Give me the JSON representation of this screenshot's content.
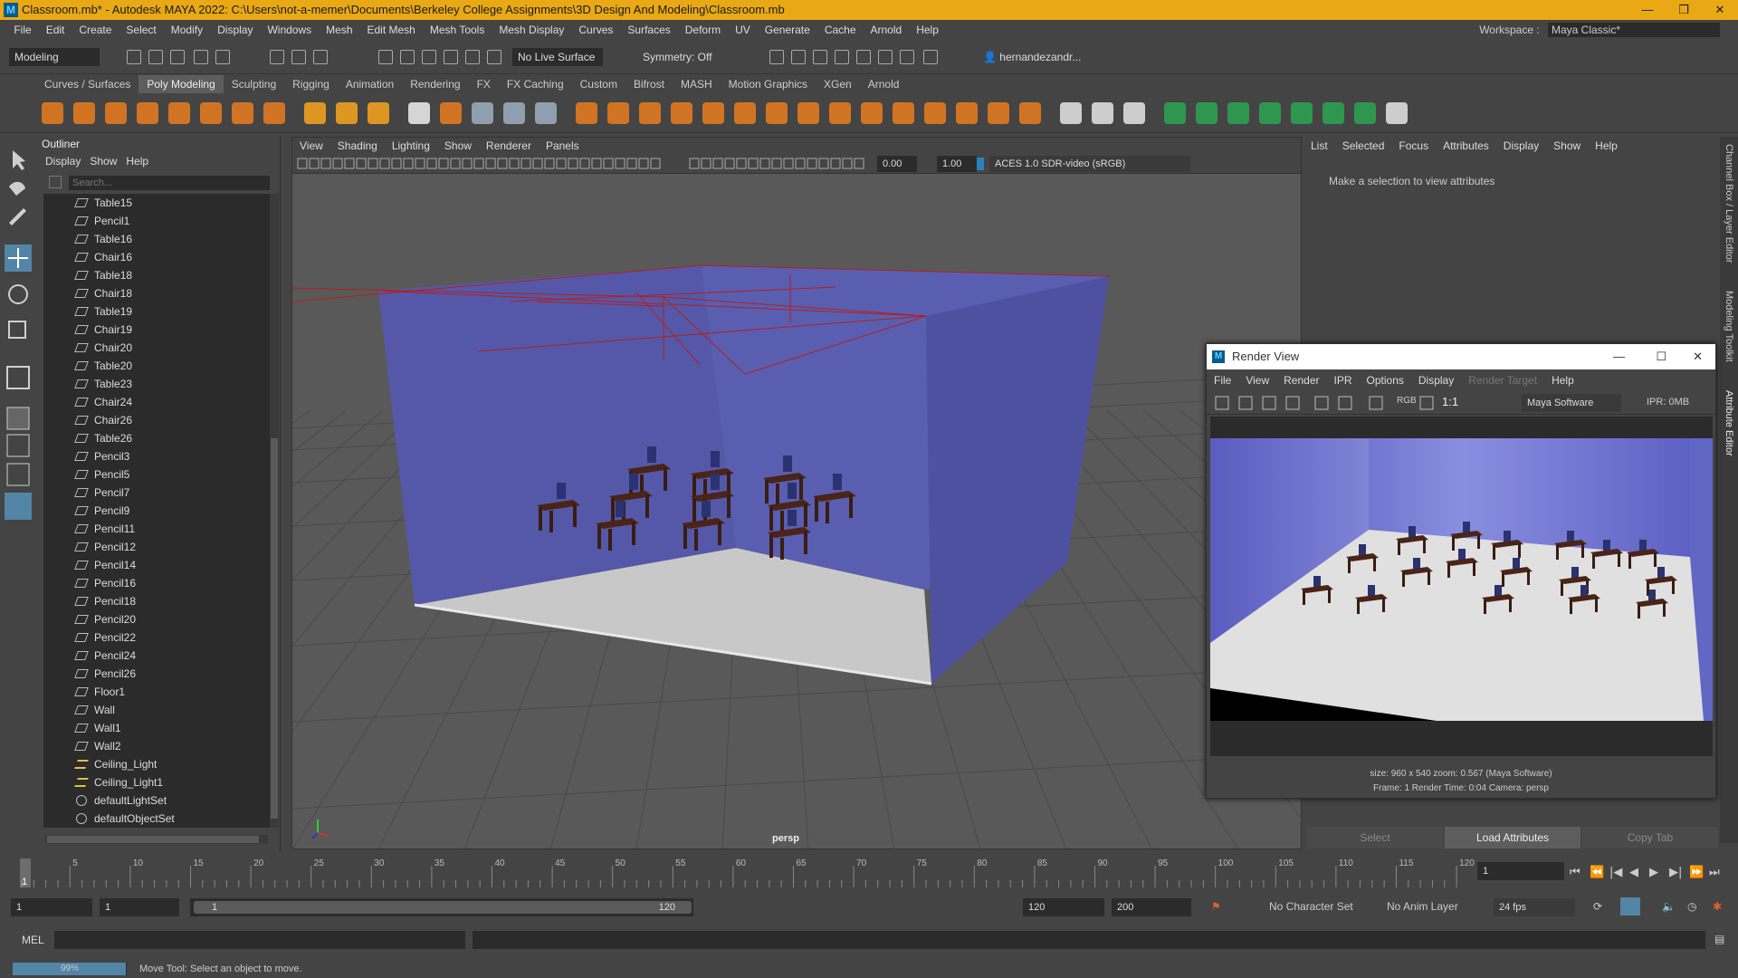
{
  "title": "Classroom.mb* - Autodesk MAYA 2022: C:\\Users\\not-a-memer\\Documents\\Berkeley College Assignments\\3D Design And Modeling\\Classroom.mb",
  "window_controls": {
    "minimize": "—",
    "maximize": "❐",
    "close": "✕"
  },
  "menubar": {
    "items": [
      "File",
      "Edit",
      "Create",
      "Select",
      "Modify",
      "Display",
      "Windows",
      "Mesh",
      "Edit Mesh",
      "Mesh Tools",
      "Mesh Display",
      "Curves",
      "Surfaces",
      "Deform",
      "UV",
      "Generate",
      "Cache",
      "Arnold",
      "Help"
    ],
    "workspace_label": "Workspace :",
    "workspace_value": "Maya Classic*"
  },
  "statusline": {
    "mode": "Modeling",
    "live_surface": "No Live Surface",
    "symmetry": "Symmetry: Off",
    "user": "hernandezandr..."
  },
  "shelf_tabs": [
    "Curves / Surfaces",
    "Poly Modeling",
    "Sculpting",
    "Rigging",
    "Animation",
    "Rendering",
    "FX",
    "FX Caching",
    "Custom",
    "Bifrost",
    "MASH",
    "Motion Graphics",
    "XGen",
    "Arnold"
  ],
  "shelf_active": "Poly Modeling",
  "outliner": {
    "title": "Outliner",
    "menu": [
      "Display",
      "Show",
      "Help"
    ],
    "search_placeholder": "Search...",
    "items": [
      {
        "name": "Table15",
        "type": "mesh"
      },
      {
        "name": "Pencil1",
        "type": "mesh"
      },
      {
        "name": "Table16",
        "type": "mesh"
      },
      {
        "name": "Chair16",
        "type": "mesh"
      },
      {
        "name": "Table18",
        "type": "mesh"
      },
      {
        "name": "Chair18",
        "type": "mesh"
      },
      {
        "name": "Table19",
        "type": "mesh"
      },
      {
        "name": "Chair19",
        "type": "mesh"
      },
      {
        "name": "Chair20",
        "type": "mesh"
      },
      {
        "name": "Table20",
        "type": "mesh"
      },
      {
        "name": "Table23",
        "type": "mesh"
      },
      {
        "name": "Chair24",
        "type": "mesh"
      },
      {
        "name": "Chair26",
        "type": "mesh"
      },
      {
        "name": "Table26",
        "type": "mesh"
      },
      {
        "name": "Pencil3",
        "type": "mesh"
      },
      {
        "name": "Pencil5",
        "type": "mesh"
      },
      {
        "name": "Pencil7",
        "type": "mesh"
      },
      {
        "name": "Pencil9",
        "type": "mesh"
      },
      {
        "name": "Pencil11",
        "type": "mesh"
      },
      {
        "name": "Pencil12",
        "type": "mesh"
      },
      {
        "name": "Pencil14",
        "type": "mesh"
      },
      {
        "name": "Pencil16",
        "type": "mesh"
      },
      {
        "name": "Pencil18",
        "type": "mesh"
      },
      {
        "name": "Pencil20",
        "type": "mesh"
      },
      {
        "name": "Pencil22",
        "type": "mesh"
      },
      {
        "name": "Pencil24",
        "type": "mesh"
      },
      {
        "name": "Pencil26",
        "type": "mesh"
      },
      {
        "name": "Floor1",
        "type": "mesh"
      },
      {
        "name": "Wall",
        "type": "mesh"
      },
      {
        "name": "Wall1",
        "type": "mesh"
      },
      {
        "name": "Wall2",
        "type": "mesh"
      },
      {
        "name": "Ceiling_Light",
        "type": "light"
      },
      {
        "name": "Ceiling_Light1",
        "type": "light"
      },
      {
        "name": "defaultLightSet",
        "type": "set"
      },
      {
        "name": "defaultObjectSet",
        "type": "set"
      }
    ]
  },
  "viewport": {
    "menu": [
      "View",
      "Shading",
      "Lighting",
      "Show",
      "Renderer",
      "Panels"
    ],
    "exposure": "0.00",
    "gamma": "1.00",
    "color_space": "ACES 1.0 SDR-video (sRGB)",
    "camera": "persp"
  },
  "attribute_editor": {
    "menu": [
      "List",
      "Selected",
      "Focus",
      "Attributes",
      "Display",
      "Show",
      "Help"
    ],
    "message": "Make a selection to view attributes",
    "buttons": [
      "Select",
      "Load Attributes",
      "Copy Tab"
    ]
  },
  "side_tabs": [
    "Channel Box / Layer Editor",
    "Modeling Toolkit",
    "Attribute Editor"
  ],
  "render_view": {
    "title": "Render View",
    "menu": [
      "File",
      "View",
      "Render",
      "IPR",
      "Options",
      "Display",
      "Render Target",
      "Help"
    ],
    "toolbar_rgb": "RGB",
    "toolbar_ratio": "1:1",
    "renderer": "Maya Software",
    "ipr": "IPR: 0MB",
    "info_line1": "size: 960 x 540  zoom: 0.567      (Maya Software)",
    "info_line2": "Frame: 1       Render Time: 0:04       Camera: persp"
  },
  "timeline": {
    "ticks": [
      "5",
      "10",
      "15",
      "20",
      "25",
      "30",
      "35",
      "40",
      "45",
      "50",
      "55",
      "60",
      "65",
      "70",
      "75",
      "80",
      "85",
      "90",
      "95",
      "100",
      "105",
      "110",
      "115",
      "120"
    ],
    "current_frame": "1",
    "current_field": "1"
  },
  "range": {
    "start": "1",
    "playback_start": "1",
    "slider_start": "1",
    "slider_end": "120",
    "playback_end": "120",
    "end": "200",
    "character_set": "No Character Set",
    "anim_layer": "No Anim Layer",
    "fps": "24 fps"
  },
  "cmdline": {
    "label": "MEL"
  },
  "helpline": {
    "progress_label": "99%",
    "progress": 0.99,
    "message": "Move Tool: Select an object to move."
  },
  "colors": {
    "title_bar": "#e8a915",
    "wall": "#5558a8",
    "floor": "#c8c8c8",
    "furniture": "#4a2418",
    "chair_back": "#2a3270",
    "light_lines": "#b02020"
  }
}
